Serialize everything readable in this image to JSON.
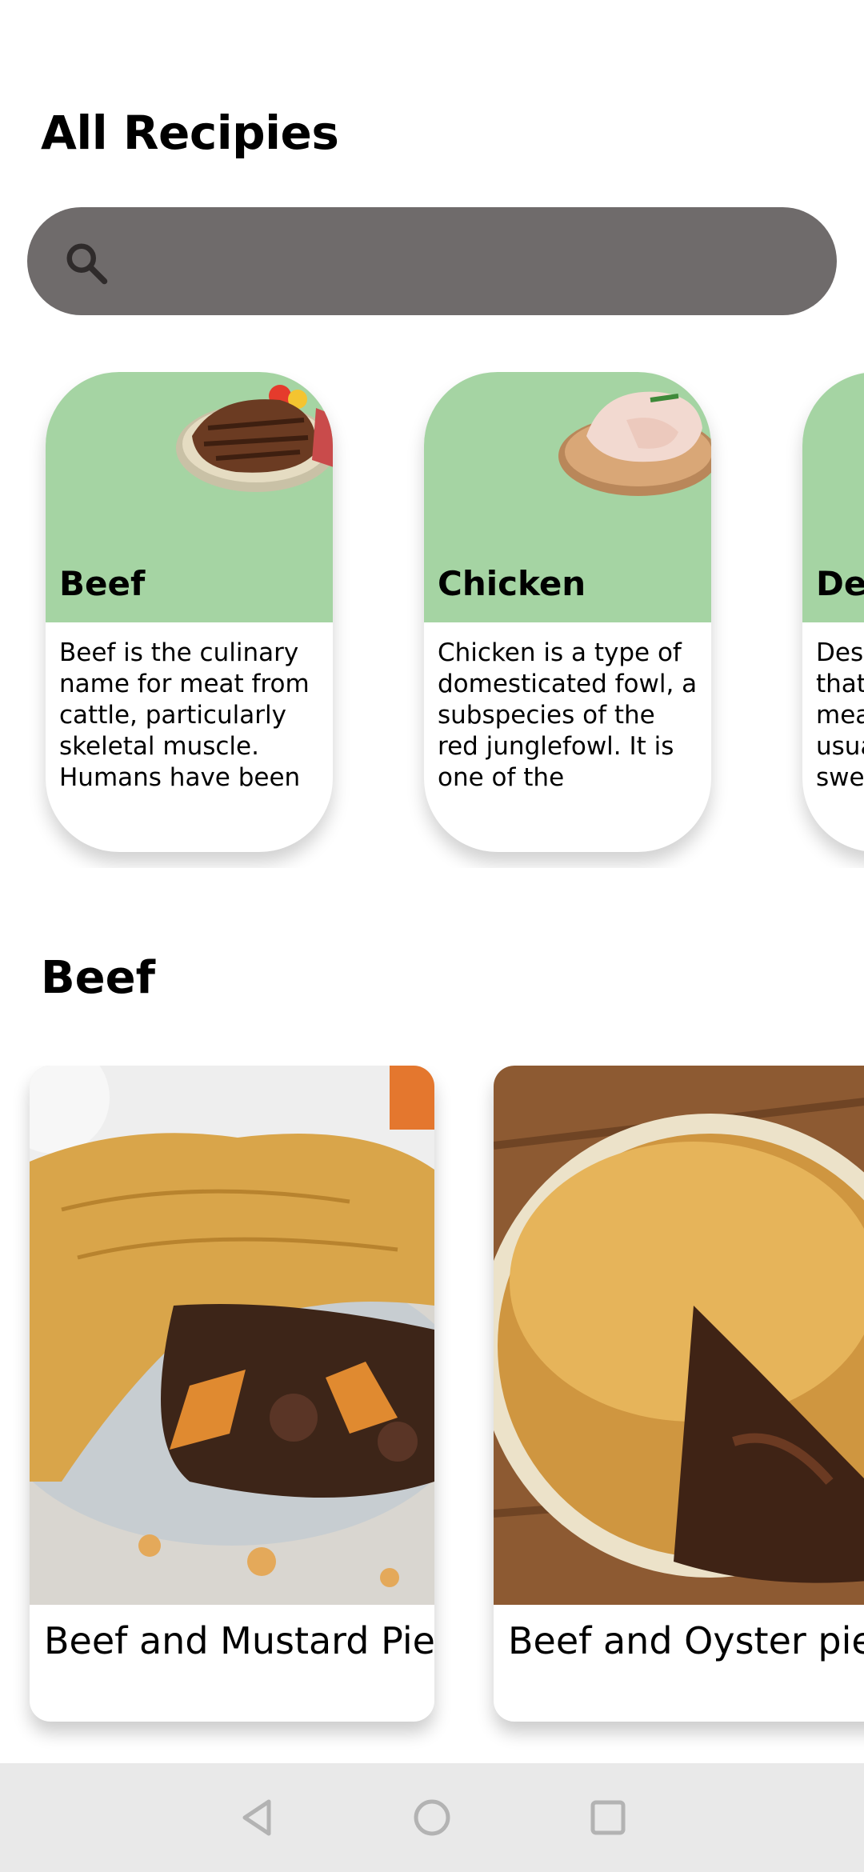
{
  "header": {
    "title": "All Recipies"
  },
  "search": {
    "placeholder": ""
  },
  "categories": [
    {
      "name": "Beef",
      "description": "Beef is the culinary name for meat from cattle, particularly skeletal muscle. Humans have been"
    },
    {
      "name": "Chicken",
      "description": "Chicken is a type of domesticated fowl, a subspecies of the red junglefowl. It is one of the"
    },
    {
      "name": "Dessert",
      "description": "Dessert is a course that concludes a meal. The course usually consists of sweet"
    }
  ],
  "section": {
    "title": "Beef"
  },
  "meals": [
    {
      "name": "Beef and Mustard Pie"
    },
    {
      "name": "Beef and Oyster pie"
    }
  ],
  "colors": {
    "accent": "#a5d4a3",
    "search_bg": "#6f6b6b",
    "nav_bg": "#e9e9e9"
  },
  "icons": [
    "search-icon",
    "back-icon",
    "home-icon",
    "recents-icon"
  ]
}
